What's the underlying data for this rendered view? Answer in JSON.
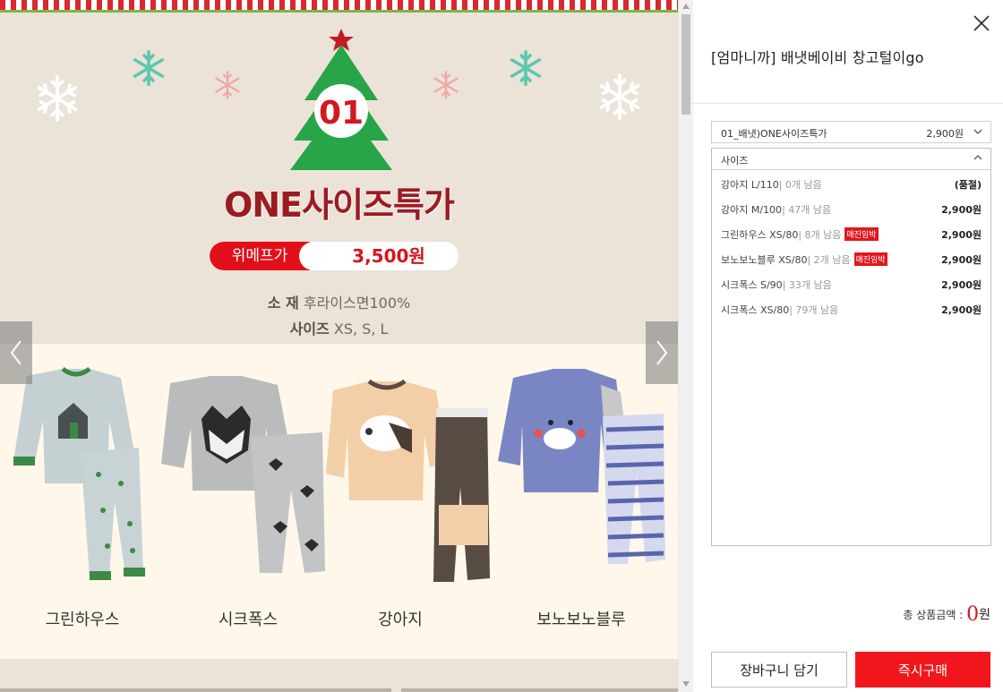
{
  "promo": {
    "tree_number": "01",
    "headline": "ONE사이즈특가",
    "price_label": "위메프가",
    "price_value": "3,500원",
    "material_label": "소   재",
    "material_value": "후라이스면100%",
    "size_label": "사이즈",
    "size_value": "XS, S, L",
    "products": [
      "그린하우스",
      "시크폭스",
      "강아지",
      "보노보노블루"
    ],
    "colors": {
      "accent_red": "#e10f1a",
      "title_red": "#9b1b22",
      "tree_green": "#28a548",
      "background": "#ebe3d8"
    }
  },
  "nav": {
    "prev_icon": "chevron-left-icon",
    "next_icon": "chevron-right-icon"
  },
  "panel": {
    "title": "[엄마니까] 배냇베이비 창고털이go",
    "select1": {
      "label": "01_배냇)ONE사이즈특가",
      "price": "2,900원"
    },
    "select2": {
      "placeholder": "사이즈",
      "options": [
        {
          "name": "강아지 L/110",
          "stock": "| 0개 남음",
          "badge": "",
          "price": "(품절)"
        },
        {
          "name": "강아지 M/100",
          "stock": "| 47개 남음",
          "badge": "",
          "price": "2,900원"
        },
        {
          "name": "그린하우스 XS/80",
          "stock": "| 8개 남음",
          "badge": "매진임박",
          "price": "2,900원"
        },
        {
          "name": "보노보노블루 XS/80",
          "stock": "| 2개 남음",
          "badge": "매진임박",
          "price": "2,900원"
        },
        {
          "name": "시크폭스 S/90",
          "stock": "| 33개 남음",
          "badge": "",
          "price": "2,900원"
        },
        {
          "name": "시크폭스 XS/80",
          "stock": "| 79개 남음",
          "badge": "",
          "price": "2,900원"
        }
      ]
    },
    "total_label": "총 상품금액 :",
    "total_value": "0",
    "total_unit": "원",
    "cart_button": "장바구니 담기",
    "buy_button": "즉시구매",
    "colors": {
      "buy": "#f0161b",
      "price_red": "#d6141d"
    }
  }
}
